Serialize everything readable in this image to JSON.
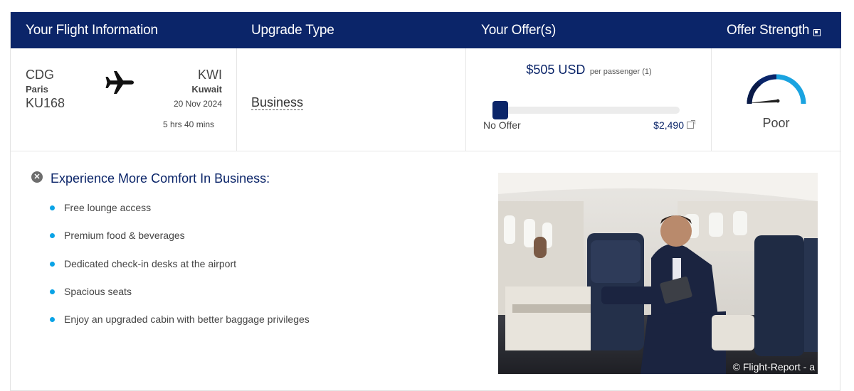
{
  "header": {
    "flight_info": "Your Flight Information",
    "upgrade_type": "Upgrade Type",
    "offers": "Your Offer(s)",
    "offer_strength": "Offer Strength",
    "offer_strength_icon": "info-icon"
  },
  "flight": {
    "origin_code": "CDG",
    "origin_city": "Paris",
    "flight_number": "KU168",
    "plane_icon": "airplane-icon",
    "destination_code": "KWI",
    "destination_city": "Kuwait",
    "date": "20 Nov 2024",
    "duration": "5 hrs 40 mins"
  },
  "upgrade": {
    "type": "Business"
  },
  "offer": {
    "amount": "$505 USD",
    "per_passenger": "per passenger (1)",
    "min_label": "No Offer",
    "max_label": "$2,490",
    "max_icon": "external-link-icon",
    "level": 0.0
  },
  "strength": {
    "label": "Poor",
    "level": 0.85
  },
  "comfort": {
    "title": "Experience More Comfort In Business:",
    "close_icon": "close-circle-icon",
    "benefits": [
      "Free lounge access",
      "Premium food & beverages",
      "Dedicated check-in desks at the airport",
      "Spacious seats",
      "Enjoy an upgraded cabin with better baggage privileges"
    ]
  },
  "photo": {
    "credit": "© Flight-Report - a"
  },
  "colors": {
    "brand_navy": "#0b2569",
    "bullet_blue": "#0aa3e6",
    "gauge_light": "#1aa3e0"
  }
}
